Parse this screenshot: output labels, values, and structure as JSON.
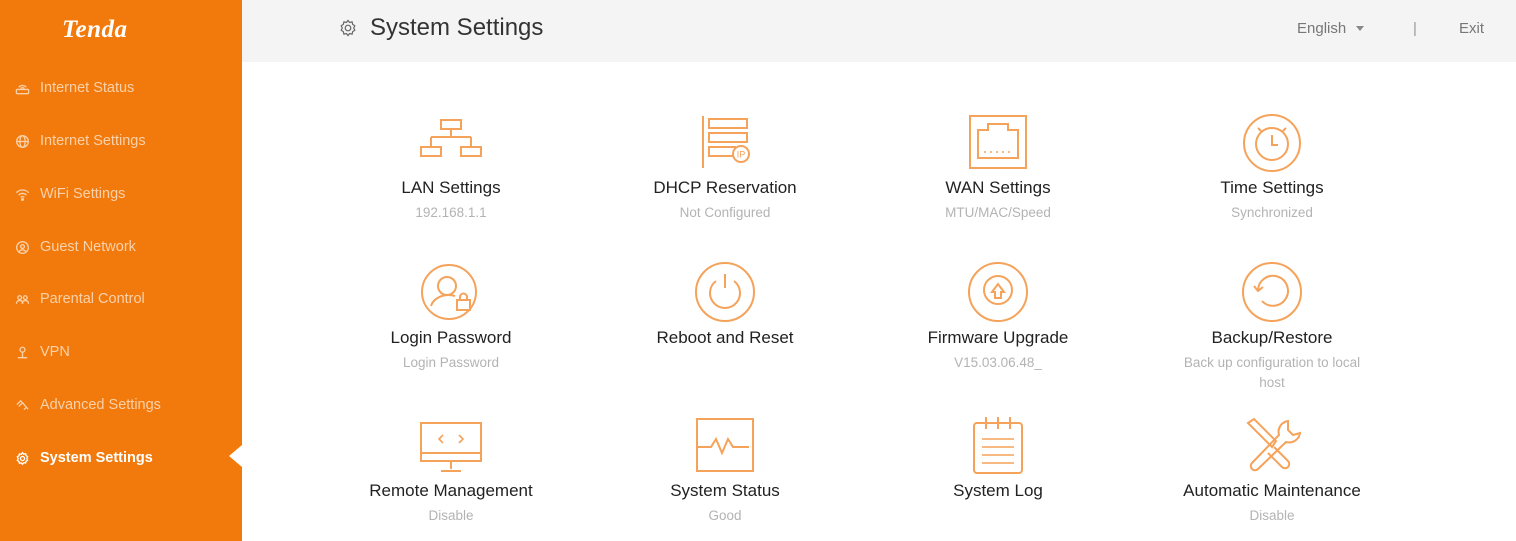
{
  "brand": {
    "logo_text": "Tenda",
    "accent_color": "#f27a0d",
    "icon_color": "#f5a25a"
  },
  "sidebar": {
    "items": [
      {
        "label": "Internet Status",
        "icon": "router-icon",
        "active": false
      },
      {
        "label": "Internet Settings",
        "icon": "globe-icon",
        "active": false
      },
      {
        "label": "WiFi Settings",
        "icon": "wifi-icon",
        "active": false
      },
      {
        "label": "Guest Network",
        "icon": "guest-wifi-icon",
        "active": false
      },
      {
        "label": "Parental Control",
        "icon": "parental-control-icon",
        "active": false
      },
      {
        "label": "VPN",
        "icon": "vpn-icon",
        "active": false
      },
      {
        "label": "Advanced Settings",
        "icon": "tools-icon",
        "active": false
      },
      {
        "label": "System Settings",
        "icon": "gear-icon",
        "active": true
      }
    ]
  },
  "header": {
    "title": "System Settings",
    "title_icon": "gear-icon",
    "language": "English",
    "separator": "|",
    "exit_label": "Exit"
  },
  "tiles": [
    {
      "label": "LAN Settings",
      "sub": "192.168.1.1",
      "icon": "lan-topology-icon"
    },
    {
      "label": "DHCP Reservation",
      "sub": "Not Configured",
      "icon": "dhcp-ip-icon"
    },
    {
      "label": "WAN Settings",
      "sub": "MTU/MAC/Speed",
      "icon": "ethernet-port-icon"
    },
    {
      "label": "Time Settings",
      "sub": "Synchronized",
      "icon": "alarm-clock-icon"
    },
    {
      "label": "Login Password",
      "sub": "Login Password",
      "icon": "user-lock-icon"
    },
    {
      "label": "Reboot and Reset",
      "sub": "",
      "icon": "power-icon"
    },
    {
      "label": "Firmware Upgrade",
      "sub": "V15.03.06.48_",
      "icon": "upgrade-arrow-icon"
    },
    {
      "label": "Backup/Restore",
      "sub": "Back up configuration to local host",
      "icon": "restore-icon"
    },
    {
      "label": "Remote Management",
      "sub": "Disable",
      "icon": "remote-monitor-icon"
    },
    {
      "label": "System Status",
      "sub": "Good",
      "icon": "heartbeat-monitor-icon"
    },
    {
      "label": "System Log",
      "sub": "",
      "icon": "log-notepad-icon"
    },
    {
      "label": "Automatic Maintenance",
      "sub": "Disable",
      "icon": "wrench-screwdriver-icon"
    }
  ]
}
